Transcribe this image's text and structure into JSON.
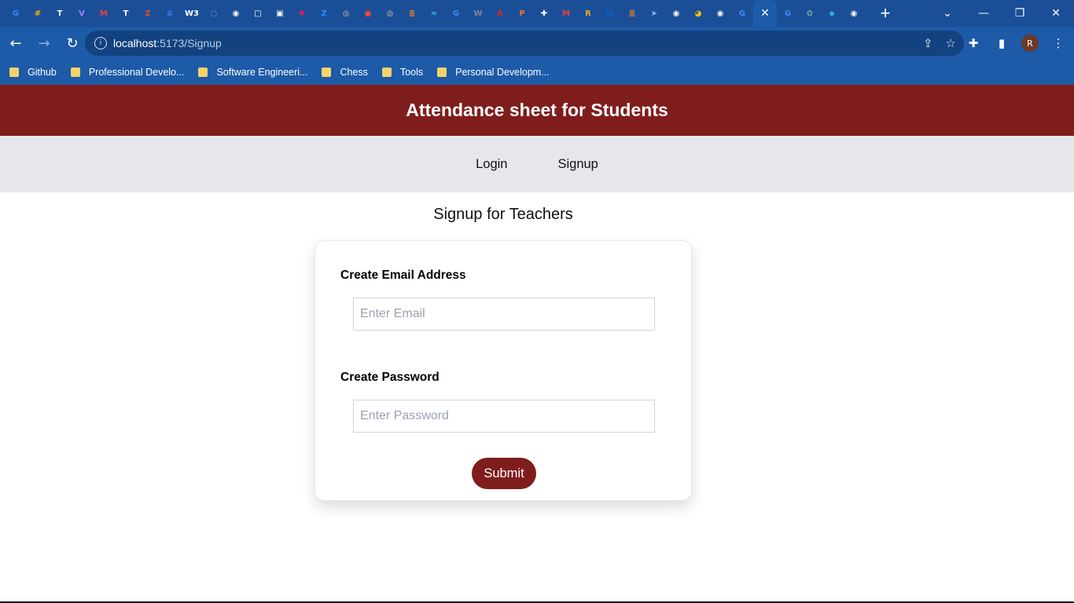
{
  "browser": {
    "tab_favicons": [
      {
        "icon": "google-icon",
        "glyph": "G",
        "color": "#4285f4"
      },
      {
        "icon": "hashnode-icon",
        "glyph": "#",
        "color": "#f5b400"
      },
      {
        "icon": "trello-icon",
        "glyph": "T",
        "color": "#ffffff"
      },
      {
        "icon": "vite-icon",
        "glyph": "V",
        "color": "#a97bff"
      },
      {
        "icon": "gmail-icon",
        "glyph": "M",
        "color": "#ea4335"
      },
      {
        "icon": "trello-icon",
        "glyph": "T",
        "color": "#ffffff"
      },
      {
        "icon": "zb-icon",
        "glyph": "Z",
        "color": "#e44d26"
      },
      {
        "icon": "docs-icon",
        "glyph": "≡",
        "color": "#4285f4"
      },
      {
        "icon": "w3schools-icon",
        "glyph": "W3",
        "color": "#ffffff"
      },
      {
        "icon": "spinner-icon",
        "glyph": "◌",
        "color": "#8ab4f8"
      },
      {
        "icon": "github-icon",
        "glyph": "◉",
        "color": "#ffffff"
      },
      {
        "icon": "square-icon",
        "glyph": "□",
        "color": "#ffffff"
      },
      {
        "icon": "notion-icon",
        "glyph": "▣",
        "color": "#ffffff"
      },
      {
        "icon": "slack-icon",
        "glyph": "✱",
        "color": "#e01e5a"
      },
      {
        "icon": "zoom-icon",
        "glyph": "Z",
        "color": "#2d8cff"
      },
      {
        "icon": "globe-icon",
        "glyph": "◍",
        "color": "#9aa0a6"
      },
      {
        "icon": "record-icon",
        "glyph": "●",
        "color": "#e8453c"
      },
      {
        "icon": "globe-icon",
        "glyph": "◍",
        "color": "#9aa0a6"
      },
      {
        "icon": "stackoverflow-icon",
        "glyph": "≣",
        "color": "#f48024"
      },
      {
        "icon": "tailwind-icon",
        "glyph": "≈",
        "color": "#38bdf8"
      },
      {
        "icon": "google-icon",
        "glyph": "G",
        "color": "#4285f4"
      },
      {
        "icon": "wikipedia-icon",
        "glyph": "W",
        "color": "#7a8aa0"
      },
      {
        "icon": "acrobat-icon",
        "glyph": "A",
        "color": "#e2231a"
      },
      {
        "icon": "postman-icon",
        "glyph": "P",
        "color": "#ff6c37"
      },
      {
        "icon": "puzzle-icon",
        "glyph": "✚",
        "color": "#ffffff"
      },
      {
        "icon": "gmail-icon",
        "glyph": "M",
        "color": "#ea4335"
      },
      {
        "icon": "r-icon",
        "glyph": "R",
        "color": "#f5a623"
      },
      {
        "icon": "linkedin-icon",
        "glyph": "in",
        "color": "#0a66c2"
      },
      {
        "icon": "stackoverflow-icon",
        "glyph": "≣",
        "color": "#f48024"
      },
      {
        "icon": "send-icon",
        "glyph": "➤",
        "color": "#8ab4f8"
      },
      {
        "icon": "github-icon",
        "glyph": "◉",
        "color": "#ffffff"
      },
      {
        "icon": "chrome-icon",
        "glyph": "◕",
        "color": "#fbbc04"
      },
      {
        "icon": "github-icon",
        "glyph": "◉",
        "color": "#ffffff"
      },
      {
        "icon": "google-icon",
        "glyph": "G",
        "color": "#4285f4"
      }
    ],
    "tab_favicons_after": [
      {
        "icon": "google-icon",
        "glyph": "G",
        "color": "#4285f4"
      },
      {
        "icon": "chatgpt-icon",
        "glyph": "✿",
        "color": "#74aa9c"
      },
      {
        "icon": "bird-icon",
        "glyph": "◆",
        "color": "#2fa6e0"
      },
      {
        "icon": "github-icon",
        "glyph": "◉",
        "color": "#ffffff"
      }
    ],
    "active_tab_glyph": "✕",
    "new_tab_glyph": "+",
    "window_controls": {
      "dropdown": "⌄",
      "minimize": "—",
      "restore": "❐",
      "close": "✕"
    },
    "nav": {
      "back": "←",
      "forward": "→",
      "reload": "↻"
    },
    "url_host": "localhost",
    "url_path": ":5173/Signup",
    "url_info_glyph": "i",
    "omnibox_actions": {
      "share": "⇪",
      "bookmark": "☆"
    },
    "toolbar_actions": {
      "extensions": "✚",
      "sidepanel": "▮",
      "profile": "R",
      "menu": "⋮"
    },
    "bookmarks": [
      "Github",
      "Professional Develo...",
      "Software Engineeri...",
      "Chess",
      "Tools",
      "Personal Developm..."
    ]
  },
  "app": {
    "title": "Attendance sheet for Students",
    "nav": {
      "login": "Login",
      "signup": "Signup"
    },
    "form": {
      "heading": "Signup for Teachers",
      "email_label": "Create Email Address",
      "email_placeholder": "Enter Email",
      "email_value": "",
      "password_label": "Create Password",
      "password_placeholder": "Enter Password",
      "password_value": "",
      "submit_label": "Submit"
    },
    "colors": {
      "primary": "#7f1d1d",
      "nav_bg": "#e5e7eb"
    }
  }
}
